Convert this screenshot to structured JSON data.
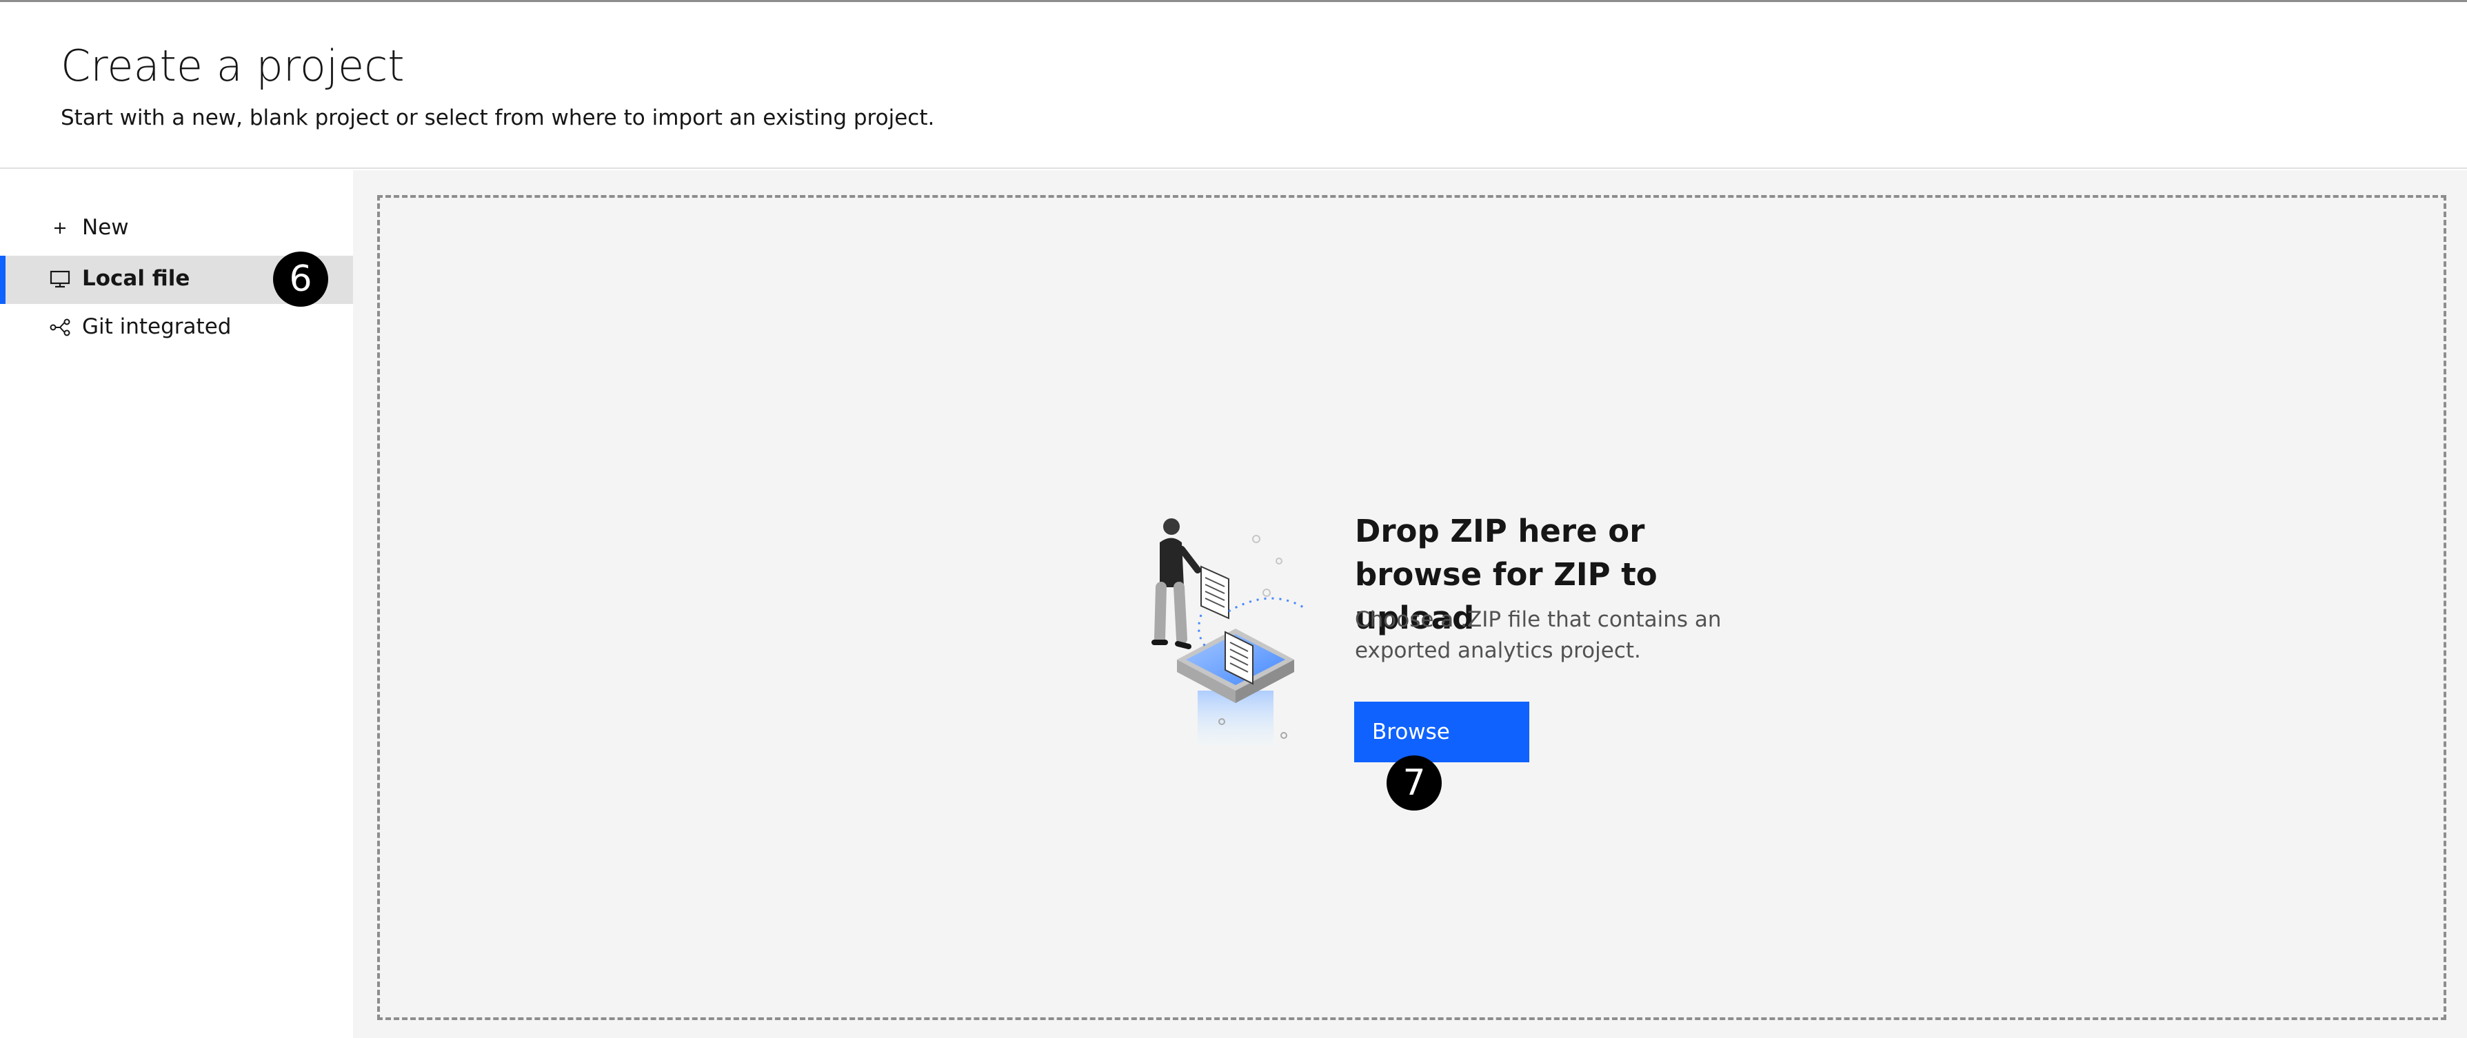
{
  "header": {
    "title": "Create a project",
    "subtitle": "Start with a new, blank project or select from where to import an existing project."
  },
  "sidebar": {
    "items": [
      {
        "label": "New",
        "icon": "plus-icon",
        "selected": false
      },
      {
        "label": "Local file",
        "icon": "computer-icon",
        "selected": true
      },
      {
        "label": "Git integrated",
        "icon": "git-branch-icon",
        "selected": false
      }
    ]
  },
  "dropzone": {
    "title": "Drop ZIP here or browse for ZIP to upload",
    "description": "Choose a .ZIP file that contains an exported analytics project.",
    "browse_label": "Browse",
    "illustration": "person-uploading-file-illustration"
  },
  "annotations": {
    "callout_1": "6",
    "callout_2": "7"
  },
  "colors": {
    "accent": "#0f62fe",
    "selected_bg": "#e0e0e0",
    "panel_bg": "#f4f4f4",
    "text_primary": "#161616",
    "text_secondary": "#525252"
  }
}
